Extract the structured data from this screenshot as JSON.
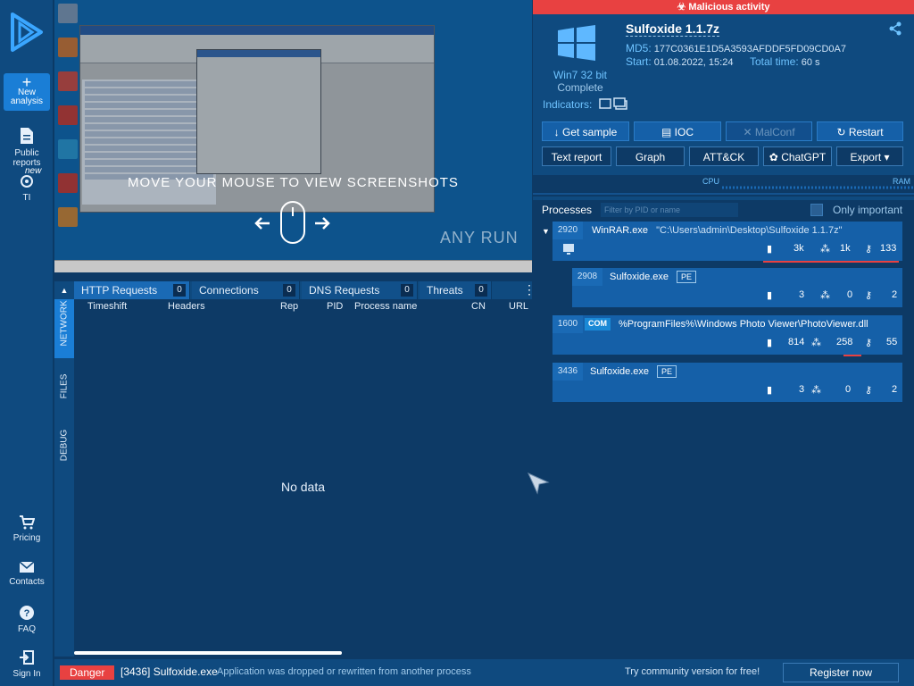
{
  "sidebar": {
    "new_analysis": "New analysis",
    "public_reports": "Public reports",
    "new_badge": "new",
    "ti": "TI",
    "pricing": "Pricing",
    "contacts": "Contacts",
    "faq": "FAQ",
    "sign_in": "Sign In"
  },
  "screenshot": {
    "overlay_text": "MOVE YOUR MOUSE TO VIEW SCREENSHOTS",
    "watermark": "ANY RUN"
  },
  "network": {
    "vtabs": [
      "NETWORK",
      "FILES",
      "DEBUG"
    ],
    "tabs": [
      {
        "label": "HTTP Requests",
        "count": "0"
      },
      {
        "label": "Connections",
        "count": "0"
      },
      {
        "label": "DNS Requests",
        "count": "0"
      },
      {
        "label": "Threats",
        "count": "0"
      }
    ],
    "columns": [
      "Timeshift",
      "Headers",
      "Rep",
      "PID",
      "Process name",
      "CN",
      "URL"
    ],
    "empty": "No data"
  },
  "report": {
    "banner": "Malicious activity",
    "title": "Sulfoxide 1.1.7z",
    "md5_label": "MD5:",
    "md5": "177C0361E1D5A3593AFDDF5FD09CD0A7",
    "start_label": "Start:",
    "start": "01.08.2022, 15:24",
    "total_label": "Total time:",
    "total": "60 s",
    "os": "Win7 32 bit",
    "state": "Complete",
    "indicators_label": "Indicators:",
    "buttons_row1": [
      "Get sample",
      "IOC",
      "MalConf",
      "Restart"
    ],
    "buttons_row2": [
      "Text report",
      "Graph",
      "ATT&CK",
      "ChatGPT",
      "Export"
    ],
    "cpu_label": "CPU",
    "ram_label": "RAM"
  },
  "processes": {
    "title": "Processes",
    "filter_placeholder": "Filter by PID or name",
    "only_important": "Only important",
    "items": [
      {
        "pid": "2920",
        "name": "WinRAR.exe",
        "args": "\"C:\\Users\\admin\\Desktop\\Sulfoxide 1.1.7z\"",
        "files": "3k",
        "reg": "1k",
        "net": "133"
      },
      {
        "pid": "2908",
        "name": "Sulfoxide.exe",
        "badge": "PE",
        "files": "3",
        "reg": "0",
        "net": "2"
      },
      {
        "pid": "1600",
        "badge": "COM",
        "name": "%ProgramFiles%\\Windows Photo Viewer\\PhotoViewer.dll",
        "files": "814",
        "reg": "258",
        "net": "55"
      },
      {
        "pid": "3436",
        "name": "Sulfoxide.exe",
        "badge": "PE",
        "files": "3",
        "reg": "0",
        "net": "2"
      }
    ]
  },
  "footer": {
    "danger": "Danger",
    "process_ref": "[3436] Sulfoxide.exe",
    "message": "Application was dropped or rewritten from another process",
    "community": "Try community version for free!",
    "register": "Register now"
  },
  "colors": {
    "accent": "#1a7ed6",
    "danger": "#e84141",
    "background": "#0d3a66"
  }
}
